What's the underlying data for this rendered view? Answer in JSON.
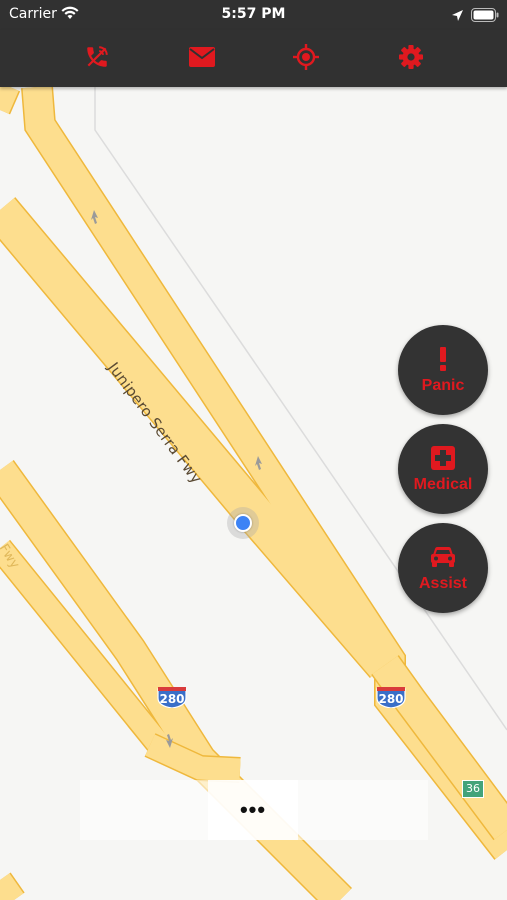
{
  "status_bar": {
    "carrier": "Carrier",
    "time": "5:57 PM",
    "icons": [
      "wifi-icon",
      "location-arrow-icon",
      "battery-icon"
    ]
  },
  "toolbar": {
    "accent_color": "#e0191f",
    "background": "#313131",
    "buttons": [
      "phone-call-icon",
      "mail-icon",
      "locate-target-icon",
      "gear-icon"
    ]
  },
  "map": {
    "road_name": "Junipero Serra Fwy",
    "faded_label": "Fwy",
    "interstate_shields": [
      "280",
      "280"
    ],
    "state_route_shield": "36"
  },
  "actions": {
    "panic": {
      "label": "Panic",
      "icon": "exclamation-icon"
    },
    "medical": {
      "label": "Medical",
      "icon": "medical-cross-icon"
    },
    "assist": {
      "label": "Assist",
      "icon": "car-icon"
    }
  },
  "more_button": {
    "label": "•••"
  }
}
